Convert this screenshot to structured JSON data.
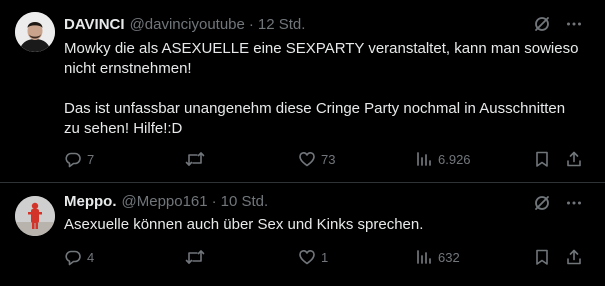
{
  "tweets": [
    {
      "display_name": "DAVINCI",
      "handle": "@davinciyoutube",
      "separator": "·",
      "time": "12 Std.",
      "paragraphs": [
        "Mowky die als ASEXUELLE eine SEXPARTY veranstaltet, kann man sowieso nicht ernstnehmen!",
        "Das ist unfassbar unangenehm diese Cringe Party nochmal in Ausschnitten zu sehen! Hilfe!:D"
      ],
      "counts": {
        "replies": "7",
        "retweets": "",
        "likes": "73",
        "views": "6.926"
      }
    },
    {
      "display_name": "Meppo.",
      "handle": "@Meppo161",
      "separator": "·",
      "time": "10 Std.",
      "paragraphs": [
        "Asexuelle können auch über Sex und Kinks sprechen."
      ],
      "counts": {
        "replies": "4",
        "retweets": "",
        "likes": "1",
        "views": "632"
      }
    }
  ],
  "icons": {
    "grok": "grok-slash-circle-icon",
    "more": "more-dots-icon",
    "reply": "reply-bubble-icon",
    "retweet": "retweet-arrows-icon",
    "like": "heart-icon",
    "views": "views-bars-icon",
    "bookmark": "bookmark-icon",
    "share": "share-upload-icon"
  },
  "colors": {
    "background": "#000000",
    "text_primary": "#e7e9ea",
    "text_secondary": "#71767b",
    "divider": "#2f3336"
  }
}
